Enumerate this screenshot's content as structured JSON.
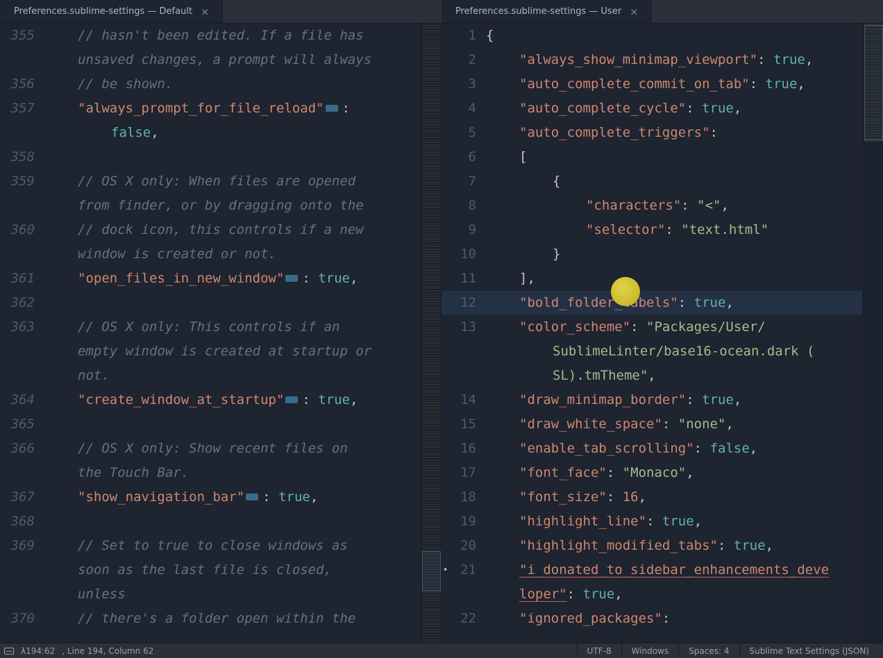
{
  "tabs": {
    "left": {
      "title": "Preferences.sublime-settings — Default"
    },
    "right": {
      "title": "Preferences.sublime-settings — User"
    }
  },
  "left_code": {
    "t355a": "// hasn't been edited. If a file has",
    "t355b": "unsaved changes, a prompt will always",
    "t356": "// be shown.",
    "k357": "\"always_prompt_for_file_reload\"",
    "v357": "false",
    "t359a": "// OS X only: When files are opened",
    "t359b": "from finder, or by dragging onto the",
    "t360a": "// dock icon, this controls if a new",
    "t360b": "window is created or not.",
    "k361": "\"open_files_in_new_window\"",
    "v361": "true",
    "t363a": "// OS X only: This controls if an",
    "t363b": "empty window is created at startup or",
    "t363c": "not.",
    "k364": "\"create_window_at_startup\"",
    "v364": "true",
    "t366a": "// OS X only: Show recent files on",
    "t366b": "the Touch Bar.",
    "k367": "\"show_navigation_bar\"",
    "v367": "true",
    "t369a": "// Set to true to close windows as",
    "t369b": "soon as the last file is closed,",
    "t369c": "unless",
    "t370": "// there's a folder open within the"
  },
  "right_code": {
    "k_always_show_minimap_viewport": "\"always_show_minimap_viewport\"",
    "v_true": "true",
    "k_auto_complete_commit_on_tab": "\"auto_complete_commit_on_tab\"",
    "k_auto_complete_cycle": "\"auto_complete_cycle\"",
    "k_auto_complete_triggers": "\"auto_complete_triggers\"",
    "k_characters": "\"characters\"",
    "v_lt": "\"<\"",
    "k_selector": "\"selector\"",
    "v_texthtml": "\"text.html\"",
    "k_bold_folder_labels": "\"bold_folder_labels\"",
    "k_color_scheme": "\"color_scheme\"",
    "v_color_scheme_a": "\"Packages/User/",
    "v_color_scheme_b": "SublimeLinter/base16-ocean.dark (",
    "v_color_scheme_c": "SL).tmTheme\"",
    "k_draw_minimap_border": "\"draw_minimap_border\"",
    "k_draw_white_space": "\"draw_white_space\"",
    "v_none": "\"none\"",
    "k_enable_tab_scrolling": "\"enable_tab_scrolling\"",
    "v_false": "false",
    "k_font_face": "\"font_face\"",
    "v_monaco": "\"Monaco\"",
    "k_font_size": "\"font_size\"",
    "v_16": "16",
    "k_highlight_line": "\"highlight_line\"",
    "k_highlight_modified_tabs": "\"highlight_modified_tabs\"",
    "k_i_donated_a": "\"i_donated_to_sidebar_enhancements_deve",
    "k_i_donated_b": "loper\"",
    "k_ignored_packages": "\"ignored_packages\""
  },
  "status": {
    "pos": "λ194:62",
    "linecol": ", Line 194, Column 62",
    "encoding": "UTF-8",
    "line_endings": "Windows",
    "spaces": "Spaces: 4",
    "syntax": "Sublime Text Settings (JSON)"
  },
  "gutters": {
    "left": [
      "355",
      "",
      "356",
      "357",
      "",
      "358",
      "359",
      "",
      "360",
      "",
      "361",
      "362",
      "363",
      "",
      "",
      "364",
      "365",
      "366",
      "",
      "367",
      "368",
      "369",
      "",
      "",
      "370"
    ],
    "right": [
      "1",
      "2",
      "3",
      "4",
      "5",
      "6",
      "7",
      "8",
      "9",
      "10",
      "11",
      "12",
      "13",
      "",
      "",
      "14",
      "15",
      "16",
      "17",
      "18",
      "19",
      "20",
      "21",
      "",
      "22"
    ]
  }
}
